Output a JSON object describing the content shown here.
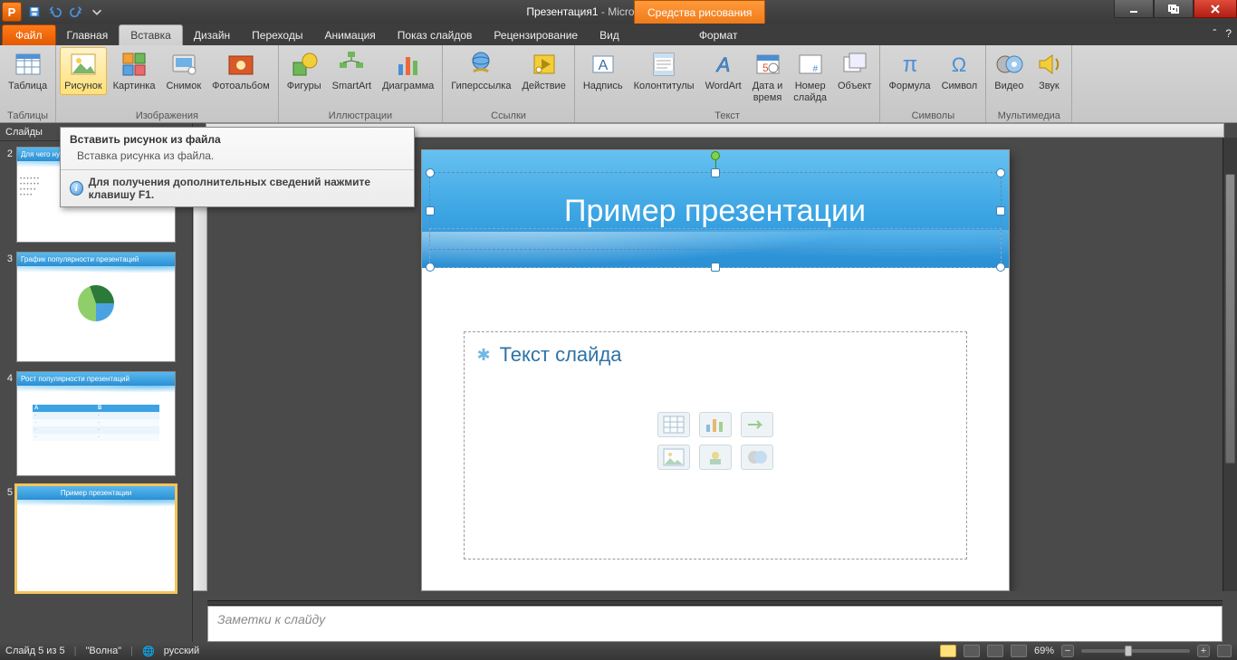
{
  "titlebar": {
    "doc": "Презентация1",
    "app": "Microsoft PowerPoint",
    "drawing_tools": "Средства рисования"
  },
  "tabs": {
    "file": "Файл",
    "home": "Главная",
    "insert": "Вставка",
    "design": "Дизайн",
    "transitions": "Переходы",
    "animation": "Анимация",
    "slideshow": "Показ слайдов",
    "review": "Рецензирование",
    "view": "Вид",
    "format": "Формат"
  },
  "ribbon": {
    "tables": {
      "table": "Таблица",
      "group": "Таблицы"
    },
    "images": {
      "picture": "Рисунок",
      "clipart": "Картинка",
      "screenshot": "Снимок",
      "album": "Фотоальбом",
      "group": "Изображения"
    },
    "illus": {
      "shapes": "Фигуры",
      "smartart": "SmartArt",
      "chart": "Диаграмма",
      "group": "Иллюстрации"
    },
    "links": {
      "hyperlink": "Гиперссылка",
      "action": "Действие",
      "group": "Ссылки"
    },
    "text": {
      "textbox": "Надпись",
      "headerfooter": "Колонтитулы",
      "wordart": "WordArt",
      "datetime1": "Дата и",
      "datetime2": "время",
      "slidenum1": "Номер",
      "slidenum2": "слайда",
      "object": "Объект",
      "group": "Текст"
    },
    "symbols": {
      "equation": "Формула",
      "symbol": "Символ",
      "group": "Символы"
    },
    "media": {
      "video": "Видео",
      "audio": "Звук",
      "group": "Мультимедиа"
    }
  },
  "tooltip": {
    "title": "Вставить рисунок из файла",
    "body": "Вставка рисунка из файла.",
    "foot": "Для получения дополнительных сведений нажмите клавишу F1."
  },
  "slidepanel": {
    "header": "Слайды"
  },
  "thumbs": {
    "t2": {
      "num": "2",
      "title": "Для чего нужны презентации"
    },
    "t3": {
      "num": "3",
      "title": "График популярности презентаций"
    },
    "t4": {
      "num": "4",
      "title": "Рост популярности презентаций"
    },
    "t5": {
      "num": "5",
      "title": "Пример презентации"
    }
  },
  "slide": {
    "title": "Пример презентации",
    "bullet": "Текст слайда"
  },
  "notes": {
    "placeholder": "Заметки к слайду"
  },
  "status": {
    "slide": "Слайд 5 из 5",
    "theme": "\"Волна\"",
    "lang": "русский",
    "zoom": "69%"
  }
}
